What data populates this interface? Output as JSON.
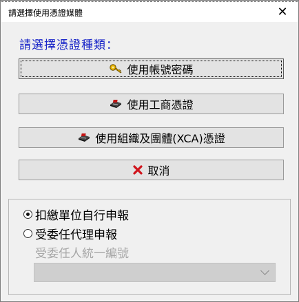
{
  "window": {
    "title": "請選擇使用憑證媒體",
    "close_glyph": "✕"
  },
  "prompt": "請選擇憑證種類：",
  "buttons": [
    {
      "label": "使用帳號密碼",
      "icon": "key-icon"
    },
    {
      "label": "使用工商憑證",
      "icon": "card-reader-icon"
    },
    {
      "label": "使用組織及團體(XCA)憑證",
      "icon": "card-reader-icon"
    },
    {
      "label": "取消",
      "icon": "red-x-icon"
    }
  ],
  "options": {
    "radio1": "扣繳單位自行申報",
    "radio2": "受委任代理申報",
    "selected": "radio1",
    "agent_id_label": "受委任人統一編號",
    "agent_id_value": ""
  },
  "colors": {
    "prompt": "#1a26c8",
    "cancel_icon": "#d0141c"
  }
}
